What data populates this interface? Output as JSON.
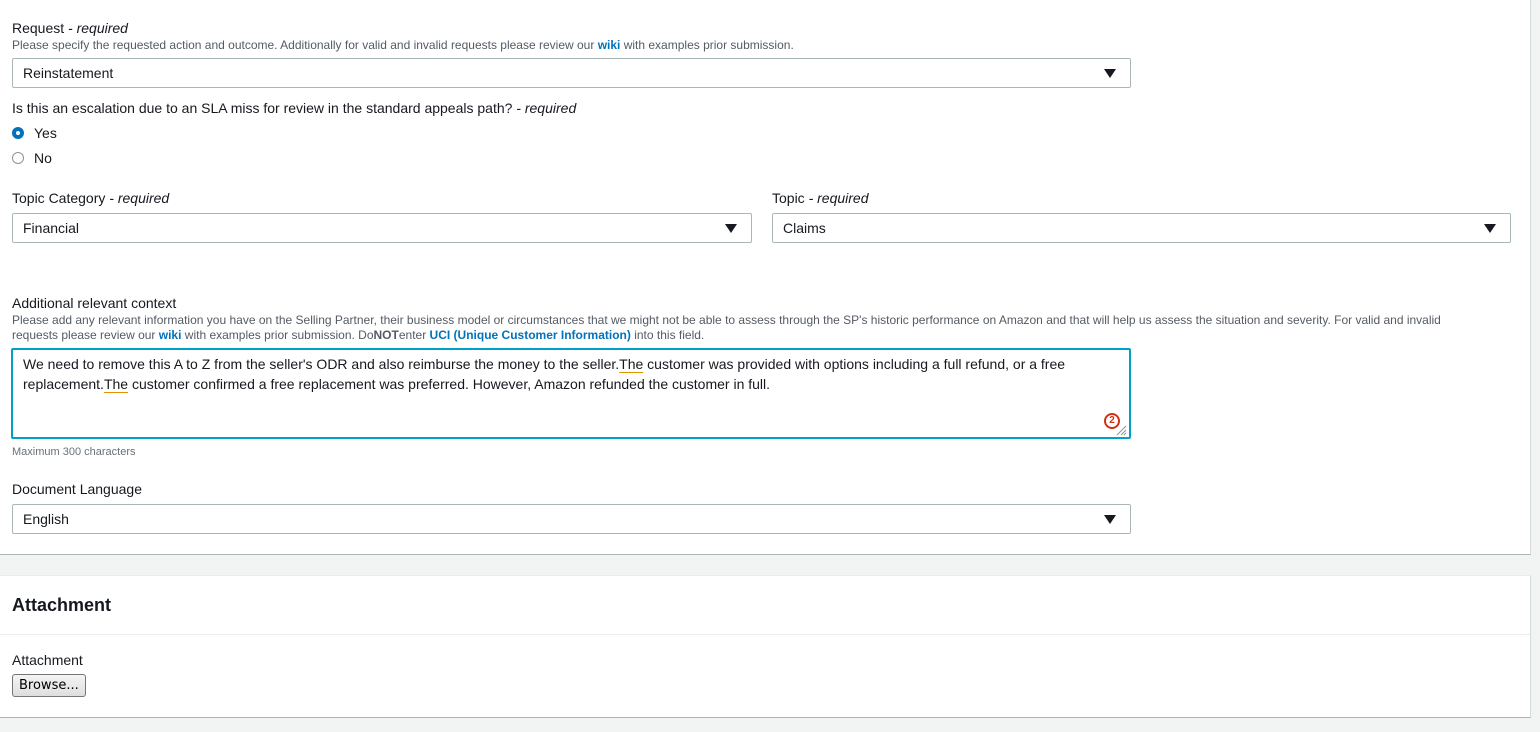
{
  "request": {
    "label": "Request",
    "required": " - required",
    "hint_prefix": "Please specify the requested action and outcome. Additionally for valid and invalid requests please review our ",
    "hint_link": "wiki",
    "hint_suffix": " with examples prior submission.",
    "value": "Reinstatement"
  },
  "escalation": {
    "question": "Is this an escalation due to an SLA miss for review in the standard appeals path?",
    "required": " - required",
    "options": [
      {
        "label": "Yes",
        "selected": true
      },
      {
        "label": "No",
        "selected": false
      }
    ]
  },
  "topic_category": {
    "label": "Topic Category",
    "required": " - required",
    "value": "Financial"
  },
  "topic": {
    "label": "Topic",
    "required": " - required",
    "value": "Claims"
  },
  "context": {
    "label": "Additional relevant context",
    "hint_line1": "Please add any relevant information you have on the Selling Partner, their business model or circumstances that we might not be able to assess through the SP's historic performance on Amazon and that will help us assess the situation and severity. For valid and invalid",
    "hint_line2_prefix": "requests please review our ",
    "hint_link": "wiki",
    "hint_line2_mid": " with examples prior submission. Do",
    "hint_not": "NOT",
    "hint_enter": "enter ",
    "hint_uci": "UCI (Unique Customer Information)",
    "hint_line2_suffix": " into this field.",
    "text_part1": "We need to remove this A to Z from the seller's ODR and also reimburse the money to the seller.",
    "text_the1": "The",
    "text_part2": " customer was provided with options including a full refund, or a free replacement.",
    "text_the2": "The",
    "text_part3": " customer confirmed a free replacement was preferred. However, Amazon refunded the customer in full.",
    "badge": "2",
    "max_note": "Maximum 300 characters"
  },
  "document_language": {
    "label": "Document Language",
    "value": "English"
  },
  "attachment_section": {
    "title": "Attachment",
    "field_label": "Attachment",
    "browse_label": "Browse..."
  },
  "colors": {
    "link": "#0073bb",
    "focus_border": "#00a1c9",
    "radio_selected": "#0073bb",
    "error_badge": "#d13212",
    "spell_underline": "#e09300"
  }
}
